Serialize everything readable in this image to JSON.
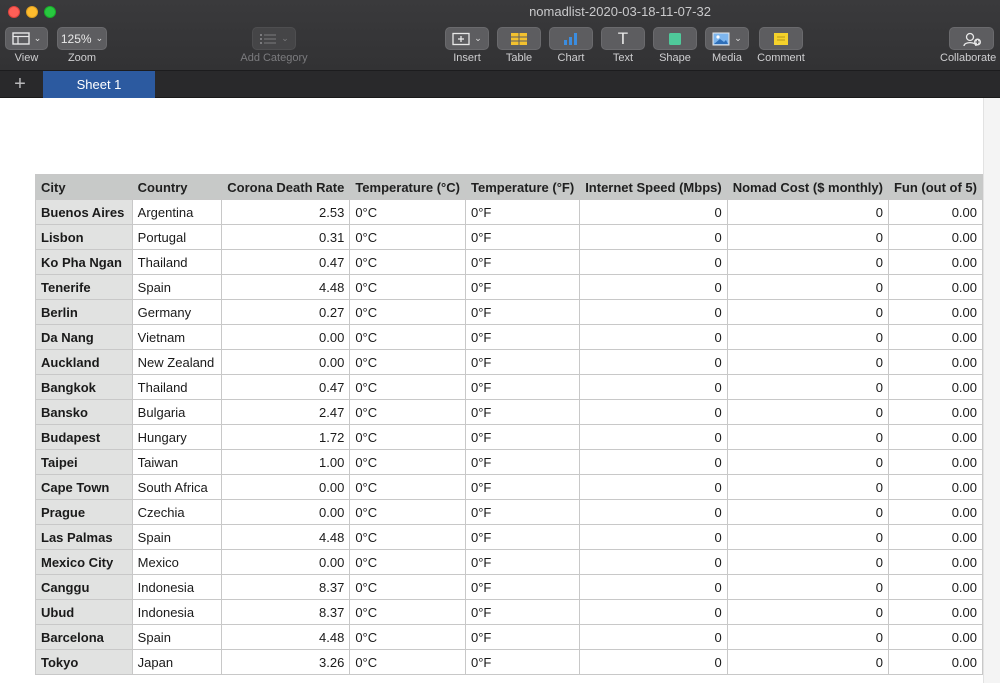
{
  "window": {
    "title": "nomadlist-2020-03-18-11-07-32"
  },
  "toolbar": {
    "view_label": "View",
    "zoom_value": "125%",
    "zoom_label": "Zoom",
    "add_category_label": "Add Category",
    "insert_label": "Insert",
    "table_label": "Table",
    "chart_label": "Chart",
    "text_label": "Text",
    "text_glyph": "T",
    "shape_label": "Shape",
    "media_label": "Media",
    "comment_label": "Comment",
    "collaborate_label": "Collaborate"
  },
  "tabs": {
    "add_glyph": "+",
    "sheet1": "Sheet 1"
  },
  "colors": {
    "table_icon": "#f3c12f",
    "chart_icon": "#3b8de0",
    "shape_icon": "#4fc99a",
    "comment_icon": "#f5d22b",
    "sheet_tab": "#2c5aa0"
  },
  "table": {
    "headers": [
      "City",
      "Country",
      "Corona Death Rate",
      "Temperature (°C)",
      "Temperature (°F)",
      "Internet Speed (Mbps)",
      "Nomad Cost ($ monthly)",
      "Fun (out of 5)"
    ],
    "rows": [
      [
        "Buenos Aires",
        "Argentina",
        "2.53",
        "0°C",
        "0°F",
        "0",
        "0",
        "0.00"
      ],
      [
        "Lisbon",
        "Portugal",
        "0.31",
        "0°C",
        "0°F",
        "0",
        "0",
        "0.00"
      ],
      [
        "Ko Pha Ngan",
        "Thailand",
        "0.47",
        "0°C",
        "0°F",
        "0",
        "0",
        "0.00"
      ],
      [
        "Tenerife",
        "Spain",
        "4.48",
        "0°C",
        "0°F",
        "0",
        "0",
        "0.00"
      ],
      [
        "Berlin",
        "Germany",
        "0.27",
        "0°C",
        "0°F",
        "0",
        "0",
        "0.00"
      ],
      [
        "Da Nang",
        "Vietnam",
        "0.00",
        "0°C",
        "0°F",
        "0",
        "0",
        "0.00"
      ],
      [
        "Auckland",
        "New Zealand",
        "0.00",
        "0°C",
        "0°F",
        "0",
        "0",
        "0.00"
      ],
      [
        "Bangkok",
        "Thailand",
        "0.47",
        "0°C",
        "0°F",
        "0",
        "0",
        "0.00"
      ],
      [
        "Bansko",
        "Bulgaria",
        "2.47",
        "0°C",
        "0°F",
        "0",
        "0",
        "0.00"
      ],
      [
        "Budapest",
        "Hungary",
        "1.72",
        "0°C",
        "0°F",
        "0",
        "0",
        "0.00"
      ],
      [
        "Taipei",
        "Taiwan",
        "1.00",
        "0°C",
        "0°F",
        "0",
        "0",
        "0.00"
      ],
      [
        "Cape Town",
        "South Africa",
        "0.00",
        "0°C",
        "0°F",
        "0",
        "0",
        "0.00"
      ],
      [
        "Prague",
        "Czechia",
        "0.00",
        "0°C",
        "0°F",
        "0",
        "0",
        "0.00"
      ],
      [
        "Las Palmas",
        "Spain",
        "4.48",
        "0°C",
        "0°F",
        "0",
        "0",
        "0.00"
      ],
      [
        "Mexico City",
        "Mexico",
        "0.00",
        "0°C",
        "0°F",
        "0",
        "0",
        "0.00"
      ],
      [
        "Canggu",
        "Indonesia",
        "8.37",
        "0°C",
        "0°F",
        "0",
        "0",
        "0.00"
      ],
      [
        "Ubud",
        "Indonesia",
        "8.37",
        "0°C",
        "0°F",
        "0",
        "0",
        "0.00"
      ],
      [
        "Barcelona",
        "Spain",
        "4.48",
        "0°C",
        "0°F",
        "0",
        "0",
        "0.00"
      ],
      [
        "Tokyo",
        "Japan",
        "3.26",
        "0°C",
        "0°F",
        "0",
        "0",
        "0.00"
      ]
    ]
  }
}
